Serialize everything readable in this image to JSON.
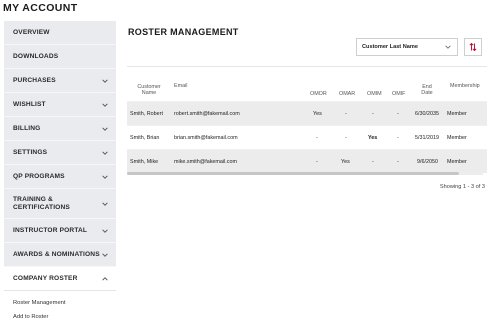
{
  "page": {
    "title": "MY ACCOUNT"
  },
  "sidebar": {
    "items": [
      {
        "label": "OVERVIEW",
        "has_chevron": false,
        "expanded": false
      },
      {
        "label": "DOWNLOADS",
        "has_chevron": false,
        "expanded": false
      },
      {
        "label": "PURCHASES",
        "has_chevron": true,
        "expanded": false
      },
      {
        "label": "WISHLIST",
        "has_chevron": true,
        "expanded": false
      },
      {
        "label": "BILLING",
        "has_chevron": true,
        "expanded": false
      },
      {
        "label": "SETTINGS",
        "has_chevron": true,
        "expanded": false
      },
      {
        "label": "QP PROGRAMS",
        "has_chevron": true,
        "expanded": false
      },
      {
        "label": "TRAINING & CERTIFICATIONS",
        "has_chevron": true,
        "expanded": false
      },
      {
        "label": "INSTRUCTOR PORTAL",
        "has_chevron": true,
        "expanded": false
      },
      {
        "label": "AWARDS & NOMINATIONS",
        "has_chevron": true,
        "expanded": false
      },
      {
        "label": "COMPANY ROSTER",
        "has_chevron": true,
        "expanded": true
      }
    ],
    "subitems": [
      {
        "label": "Roster Management"
      },
      {
        "label": "Add to Roster"
      }
    ]
  },
  "main": {
    "title": "ROSTER MANAGEMENT",
    "sort": {
      "selected": "Customer Last Name"
    }
  },
  "table": {
    "columns": [
      "Customer Name",
      "Email",
      "OMOR",
      "OMAR",
      "OMIM",
      "OMIF",
      "End Date",
      "Membership"
    ],
    "rows": [
      {
        "name": "Smith, Robert",
        "email": "robert.smith@fakemail.com",
        "omor": "Yes",
        "omar": "-",
        "omim": "-",
        "omif": "-",
        "end_date": "6/30/2035",
        "membership": "Member"
      },
      {
        "name": "Smith, Brian",
        "email": "brian.smith@fakemail.com",
        "omor": "-",
        "omar": "-",
        "omim": "Yes",
        "omif": "-",
        "end_date": "5/31/2019",
        "membership": "Member"
      },
      {
        "name": "Smith, Mike",
        "email": "mike.smith@fakemail.com",
        "omor": "-",
        "omar": "Yes",
        "omim": "-",
        "omif": "-",
        "end_date": "9/6/2050",
        "membership": "Member"
      }
    ],
    "showing": "Showing 1 - 3 of 3"
  }
}
